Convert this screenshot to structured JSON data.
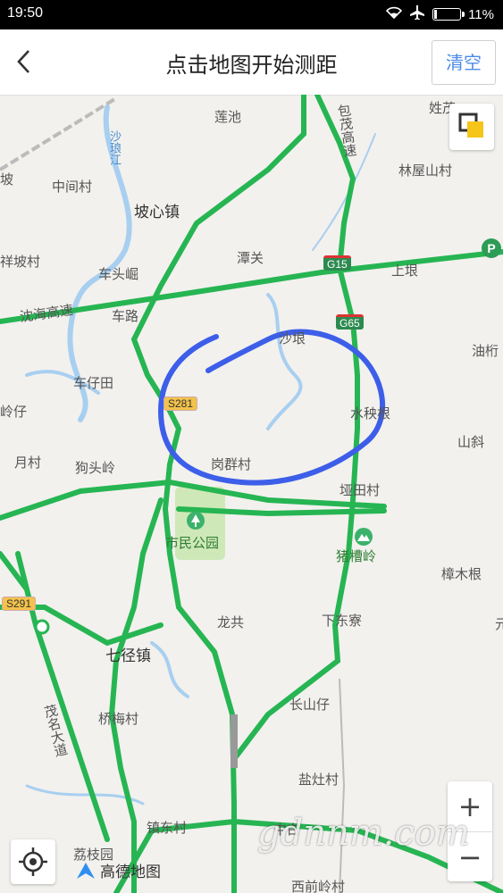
{
  "status_bar": {
    "time": "19:50",
    "battery": "11%",
    "battery_level": 0.11
  },
  "header": {
    "title": "点击地图开始测距",
    "clear_label": "清空"
  },
  "map": {
    "places": [
      "莲池",
      "包茂高速",
      "姓茂",
      "中间村",
      "林屋山村",
      "坡心镇",
      "坡",
      "沙琅江",
      "祥坡村",
      "潭关",
      "上垠",
      "车头崛",
      "沈海高速",
      "车路",
      "沙垠",
      "油桁",
      "车仔田",
      "水秧根",
      "岭仔",
      "月村",
      "狗头岭",
      "岗群村",
      "山斜",
      "垭田村",
      "市民公园",
      "猪槽岭",
      "樟木根",
      "龙共",
      "下东寮",
      "七径镇",
      "长山仔",
      "桥梅村",
      "茂名大道",
      "盐灶村",
      "镇东村",
      "荔枝园",
      "西前岭村",
      "中白",
      "元"
    ],
    "shields": [
      "G15",
      "G65",
      "S281",
      "S291"
    ]
  },
  "controls": {
    "zoom_in": "+",
    "zoom_out": "−"
  },
  "logo": "高德地图",
  "watermark": "gdnnm.com"
}
